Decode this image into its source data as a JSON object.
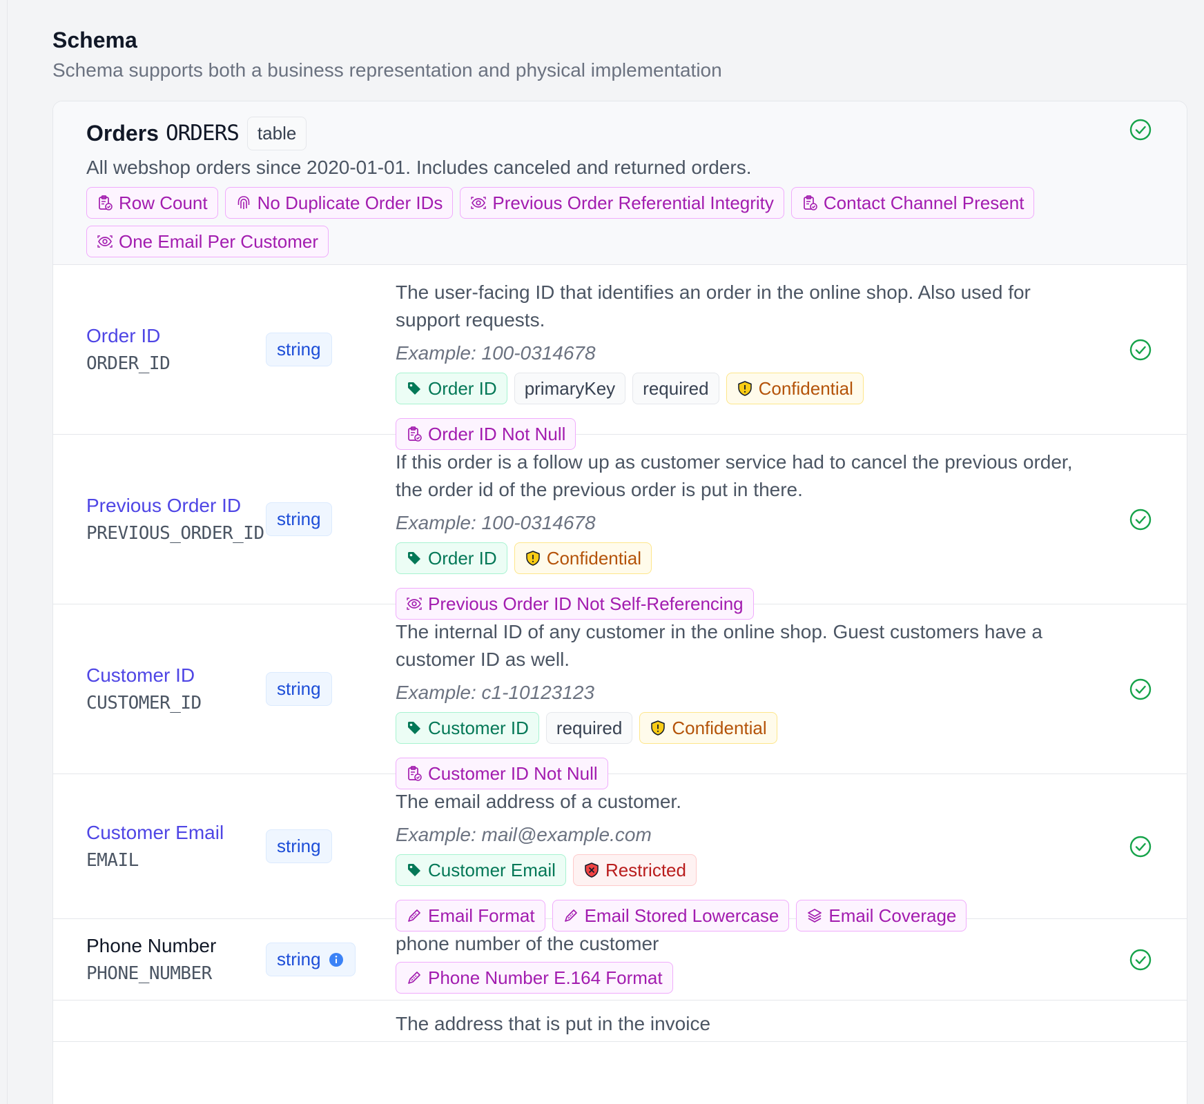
{
  "section": {
    "title": "Schema",
    "subtitle": "Schema supports both a business representation and physical implementation"
  },
  "table": {
    "name": "Orders",
    "physical_name": "ORDERS",
    "type": "table",
    "description": "All webshop orders since 2020-01-01. Includes canceled and returned orders.",
    "status_icon": "check-circle-icon",
    "quality_checks": [
      {
        "label": "Row Count",
        "icon": "clipboard-check-icon"
      },
      {
        "label": "No Duplicate Order IDs",
        "icon": "fingerprint-icon"
      },
      {
        "label": "Previous Order Referential Integrity",
        "icon": "eye-scan-icon"
      },
      {
        "label": "Contact Channel Present",
        "icon": "clipboard-check-icon"
      },
      {
        "label": "One Email Per Customer",
        "icon": "eye-scan-icon"
      }
    ]
  },
  "fields": [
    {
      "name": "Order ID",
      "physical_name": "ORDER_ID",
      "type": "string",
      "description": "The user-facing ID that identifies an order in the online shop. Also used for support requests.",
      "example": "Example: 100-0314678",
      "term": "Order ID",
      "flags": [
        "primaryKey",
        "required"
      ],
      "classification": "Confidential",
      "quality_checks": [
        {
          "label": "Order ID Not Null",
          "icon": "clipboard-check-icon"
        }
      ]
    },
    {
      "name": "Previous Order ID",
      "physical_name": "PREVIOUS_ORDER_ID",
      "type": "string",
      "description": "If this order is a follow up as customer service had to cancel the previous order, the order id of the previous order is put in there.",
      "example": "Example: 100-0314678",
      "term": "Order ID",
      "flags": [],
      "classification": "Confidential",
      "quality_checks": [
        {
          "label": "Previous Order ID Not Self-Referencing",
          "icon": "eye-scan-icon"
        }
      ]
    },
    {
      "name": "Customer ID",
      "physical_name": "CUSTOMER_ID",
      "type": "string",
      "description": "The internal ID of any customer in the online shop. Guest customers have a customer ID as well.",
      "example": "Example: c1-10123123",
      "term": "Customer ID",
      "flags": [
        "required"
      ],
      "classification": "Confidential",
      "quality_checks": [
        {
          "label": "Customer ID Not Null",
          "icon": "clipboard-check-icon"
        }
      ]
    },
    {
      "name": "Customer Email",
      "physical_name": "EMAIL",
      "type": "string",
      "description": "The email address of a customer.",
      "example": "Example: mail@example.com",
      "term": "Customer Email",
      "flags": [],
      "classification": "Restricted",
      "quality_checks": [
        {
          "label": "Email Format",
          "icon": "ruler-pen-icon"
        },
        {
          "label": "Email Stored Lowercase",
          "icon": "ruler-pen-icon"
        },
        {
          "label": "Email Coverage",
          "icon": "layers-icon"
        }
      ]
    },
    {
      "name": "Phone Number",
      "physical_name": "PHONE_NUMBER",
      "type": "string",
      "description": "phone number of the customer",
      "quality_checks": [
        {
          "label": "Phone Number E.164 Format",
          "icon": "ruler-pen-icon"
        }
      ]
    },
    {
      "description": "The address that is put in the invoice"
    }
  ],
  "colors": {
    "link": "#4f46e5",
    "quality": "#a21caf",
    "term": "#047857",
    "confidential": "#b45309",
    "restricted": "#b91c1c",
    "success": "#16a34a"
  }
}
